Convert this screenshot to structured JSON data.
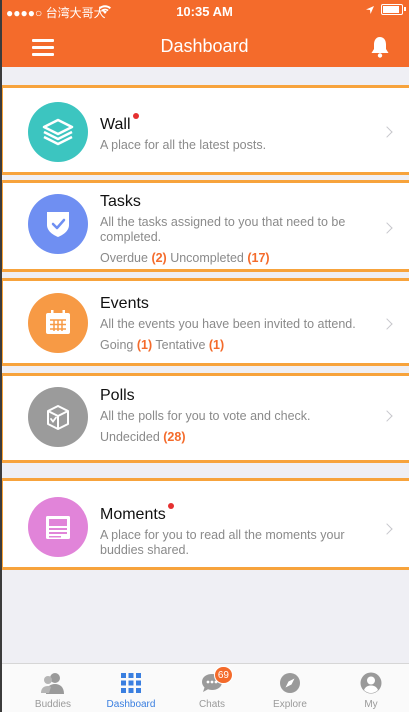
{
  "status": {
    "carrier": "●●●●○ 台湾大哥大",
    "time": "10:35 AM"
  },
  "header": {
    "title": "Dashboard"
  },
  "cards": [
    {
      "title": "Wall",
      "has_dot": true,
      "desc": "A place for all the latest posts.",
      "icon": "layers-icon",
      "color": "#3cc5c0"
    },
    {
      "title": "Tasks",
      "has_dot": false,
      "desc": "All the tasks assigned to you that need to be completed.",
      "icon": "shield-check-icon",
      "color": "#6f8ff2",
      "stats": [
        {
          "label": "Overdue",
          "count": "(2)"
        },
        {
          "label": "Uncompleted",
          "count": "(17)"
        }
      ]
    },
    {
      "title": "Events",
      "has_dot": false,
      "desc": "All the events you have been invited to attend.",
      "icon": "calendar-icon",
      "color": "#f79a45",
      "stats": [
        {
          "label": "Going",
          "count": "(1)"
        },
        {
          "label": "Tentative",
          "count": "(1)"
        }
      ]
    },
    {
      "title": "Polls",
      "has_dot": false,
      "desc": "All the polls for you to vote and check.",
      "icon": "ballot-box-icon",
      "color": "#9b9b9b",
      "stats": [
        {
          "label": "Undecided",
          "count": "(28)"
        }
      ]
    },
    {
      "title": "Moments",
      "has_dot": true,
      "desc": "A place for you to read all the moments your buddies shared.",
      "icon": "moments-icon",
      "color": "#e184d9"
    }
  ],
  "tabs": [
    {
      "label": "Buddies",
      "icon": "buddies-icon"
    },
    {
      "label": "Dashboard",
      "icon": "grid-icon",
      "active": true
    },
    {
      "label": "Chats",
      "icon": "chat-icon",
      "badge": "69"
    },
    {
      "label": "Explore",
      "icon": "compass-icon"
    },
    {
      "label": "My",
      "icon": "person-icon"
    }
  ],
  "colors": {
    "accent": "#f46b2b",
    "highlight_border": "#f7a33c",
    "active_tab": "#3a7fe0"
  }
}
